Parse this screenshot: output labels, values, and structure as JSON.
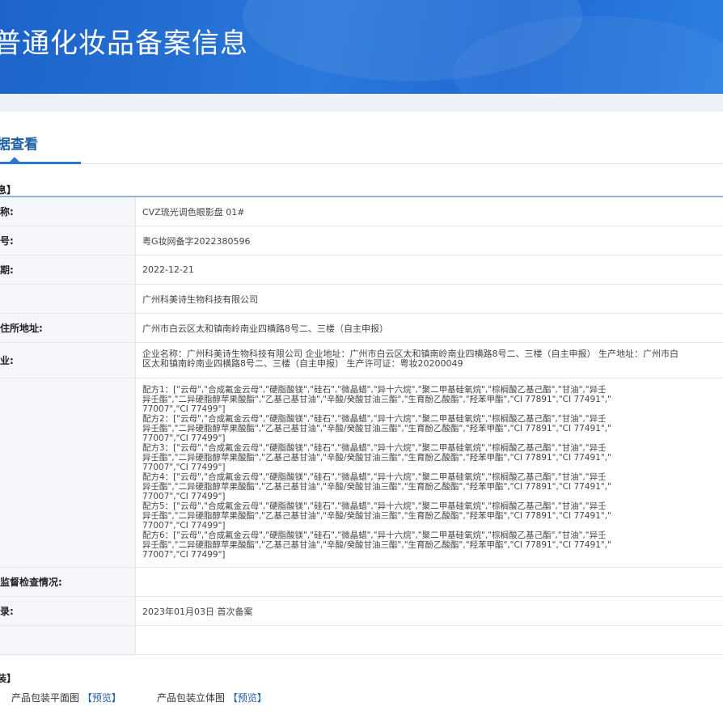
{
  "header": {
    "title": "普通化妆品备案信息"
  },
  "tab": {
    "label": "据查看"
  },
  "section1": {
    "title": "息】"
  },
  "rows": [
    {
      "label": "称:",
      "value": "CVZ琉光调色眼影盘 01#"
    },
    {
      "label": "号:",
      "value": "粤G妆网备字2022380596"
    },
    {
      "label": "期:",
      "value": "2022-12-21"
    },
    {
      "label": "",
      "value": "广州科美诗生物科技有限公司"
    },
    {
      "label": "住所地址:",
      "value": "广州市白云区太和镇南岭南业四横路8号二、三楼（自主申报）"
    },
    {
      "label": "业:",
      "value_line1": "企业名称：广州科美诗生物科技有限公司 企业地址：广州市白云区太和镇南岭南业四横路8号二、三楼（自主申报） 生产地址：广州市白",
      "value_line2": "区太和镇南岭南业四横路8号二、三楼（自主申报） 生产许可证：粤妆20200049"
    },
    {
      "label": "",
      "formulas": [
        "配方1：[\"云母\",\"合成氟金云母\",\"硬脂酸镁\",\"硅石\",\"微晶蜡\",\"异十六烷\",\"聚二甲基硅氧烷\",\"棕榈酸乙基己酯\",\"甘油\",\"异壬",
        "异壬酯\",\"二异硬脂醇苹果酸酯\",\"乙基己基甘油\",\"辛酸/癸酸甘油三酯\",\"生育酚乙酸酯\",\"羟苯甲酯\",\"CI 77891\",\"CI 77491\",\"",
        "77007\",\"CI 77499\"]",
        "配方2：[\"云母\",\"合成氟金云母\",\"硬脂酸镁\",\"硅石\",\"微晶蜡\",\"异十六烷\",\"聚二甲基硅氧烷\",\"棕榈酸乙基己酯\",\"甘油\",\"异壬",
        "异壬酯\",\"二异硬脂醇苹果酸酯\",\"乙基己基甘油\",\"辛酸/癸酸甘油三酯\",\"生育酚乙酸酯\",\"羟苯甲酯\",\"CI 77891\",\"CI 77491\",\"",
        "77007\",\"CI 77499\"]",
        "配方3：[\"云母\",\"合成氟金云母\",\"硬脂酸镁\",\"硅石\",\"微晶蜡\",\"异十六烷\",\"聚二甲基硅氧烷\",\"棕榈酸乙基己酯\",\"甘油\",\"异壬",
        "异壬酯\",\"二异硬脂醇苹果酸酯\",\"乙基己基甘油\",\"辛酸/癸酸甘油三酯\",\"生育酚乙酸酯\",\"羟苯甲酯\",\"CI 77891\",\"CI 77491\",\"",
        "77007\",\"CI 77499\"]",
        "配方4：[\"云母\",\"合成氟金云母\",\"硬脂酸镁\",\"硅石\",\"微晶蜡\",\"异十六烷\",\"聚二甲基硅氧烷\",\"棕榈酸乙基己酯\",\"甘油\",\"异壬",
        "异壬酯\",\"二异硬脂醇苹果酸酯\",\"乙基己基甘油\",\"辛酸/癸酸甘油三酯\",\"生育酚乙酸酯\",\"羟苯甲酯\",\"CI 77891\",\"CI 77491\",\"",
        "77007\",\"CI 77499\"]",
        "配方5：[\"云母\",\"合成氟金云母\",\"硬脂酸镁\",\"硅石\",\"微晶蜡\",\"异十六烷\",\"聚二甲基硅氧烷\",\"棕榈酸乙基己酯\",\"甘油\",\"异壬",
        "异壬酯\",\"二异硬脂醇苹果酸酯\",\"乙基己基甘油\",\"辛酸/癸酸甘油三酯\",\"生育酚乙酸酯\",\"羟苯甲酯\",\"CI 77891\",\"CI 77491\",\"",
        "77007\",\"CI 77499\"]",
        "配方6：[\"云母\",\"合成氟金云母\",\"硬脂酸镁\",\"硅石\",\"微晶蜡\",\"异十六烷\",\"聚二甲基硅氧烷\",\"棕榈酸乙基己酯\",\"甘油\",\"异壬",
        "异壬酯\",\"二异硬脂醇苹果酸酯\",\"乙基己基甘油\",\"辛酸/癸酸甘油三酯\",\"生育酚乙酸酯\",\"羟苯甲酯\",\"CI 77891\",\"CI 77491\",\"",
        "77007\",\"CI 77499\"]"
      ]
    },
    {
      "label": "监督检查情况:",
      "value": ""
    },
    {
      "label": "录:",
      "value": "2023年01月03日 首次备案"
    },
    {
      "label": "",
      "value": ""
    }
  ],
  "section2": {
    "title": "装】"
  },
  "packaging": {
    "flat_label": "产品包装平面图",
    "flat_link": "【预览】",
    "stereo_label": "产品包装立体图",
    "stereo_link": "【预览】"
  },
  "colors": {
    "banner": "#2a78db",
    "accent": "#1e5ea8"
  }
}
